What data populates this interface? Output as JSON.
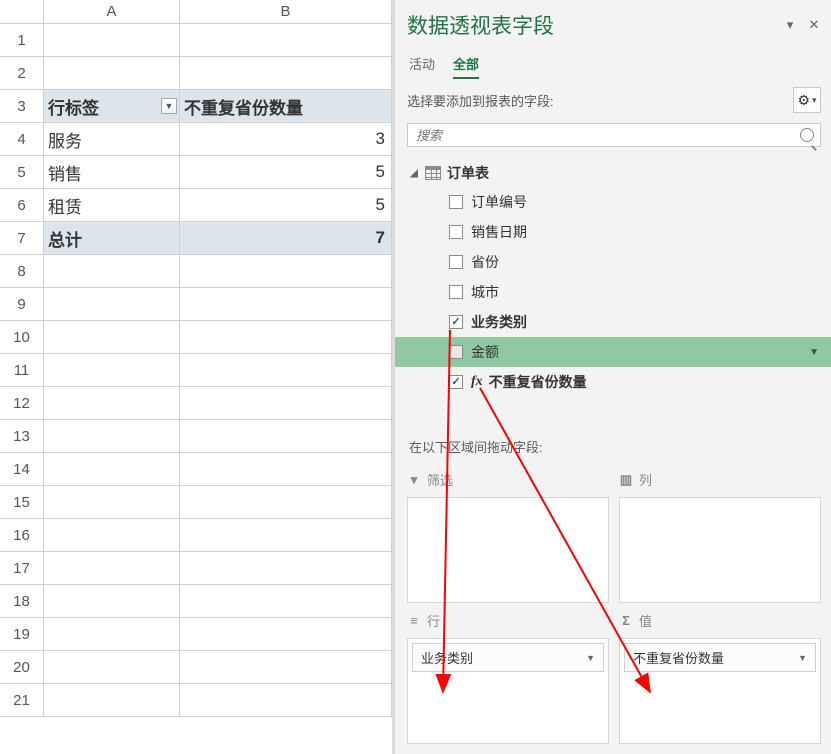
{
  "sheet": {
    "columns": [
      "A",
      "B"
    ],
    "row_count": 21,
    "header_row": 3,
    "header_a": "行标签",
    "header_b": "不重复省份数量",
    "data_rows": [
      {
        "label": "服务",
        "value": "3"
      },
      {
        "label": "销售",
        "value": "5"
      },
      {
        "label": "租赁",
        "value": "5"
      }
    ],
    "total_label": "总计",
    "total_value": "7"
  },
  "panel": {
    "title": "数据透视表字段",
    "tabs": {
      "active": "活动",
      "all": "全部",
      "active_index": 1
    },
    "subtitle": "选择要添加到报表的字段:",
    "search_placeholder": "搜索",
    "table_name": "订单表",
    "fields": [
      {
        "label": "订单编号",
        "checked": false,
        "calc": false
      },
      {
        "label": "销售日期",
        "checked": false,
        "calc": false
      },
      {
        "label": "省份",
        "checked": false,
        "calc": false
      },
      {
        "label": "城市",
        "checked": false,
        "calc": false
      },
      {
        "label": "业务类别",
        "checked": true,
        "calc": false,
        "bold": true
      },
      {
        "label": "金额",
        "checked": false,
        "calc": false,
        "highlight": true
      },
      {
        "label": "不重复省份数量",
        "checked": true,
        "calc": true,
        "bold": true
      }
    ],
    "areas_title": "在以下区域间拖动字段:",
    "areas": {
      "filter": {
        "label": "筛选"
      },
      "columns": {
        "label": "列"
      },
      "rows": {
        "label": "行",
        "item": "业务类别"
      },
      "values": {
        "label": "值",
        "item": "不重复省份数量"
      }
    }
  }
}
